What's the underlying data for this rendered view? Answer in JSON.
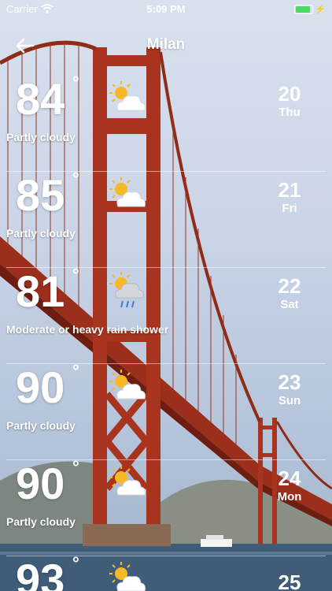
{
  "status_bar": {
    "carrier": "Carrier",
    "time": "5:09 PM",
    "battery_color": "#4cd964",
    "battery_level": 0.9
  },
  "nav": {
    "title": "Milan",
    "back_icon": "arrow-left-icon"
  },
  "degree_symbol": "°",
  "forecast": [
    {
      "temp": "84",
      "condition": "Partly cloudy",
      "icon": "partly-cloudy-icon",
      "day_num": "20",
      "day_name": "Thu"
    },
    {
      "temp": "85",
      "condition": "Partly cloudy",
      "icon": "partly-cloudy-icon",
      "day_num": "21",
      "day_name": "Fri"
    },
    {
      "temp": "81",
      "condition": "Moderate or heavy rain shower",
      "icon": "rain-shower-icon",
      "day_num": "22",
      "day_name": "Sat"
    },
    {
      "temp": "90",
      "condition": "Partly cloudy",
      "icon": "partly-cloudy-icon",
      "day_num": "23",
      "day_name": "Sun"
    },
    {
      "temp": "90",
      "condition": "Partly cloudy",
      "icon": "partly-cloudy-icon",
      "day_num": "24",
      "day_name": "Mon"
    },
    {
      "temp": "93",
      "condition": "",
      "icon": "partly-cloudy-icon",
      "day_num": "25",
      "day_name": ""
    }
  ]
}
